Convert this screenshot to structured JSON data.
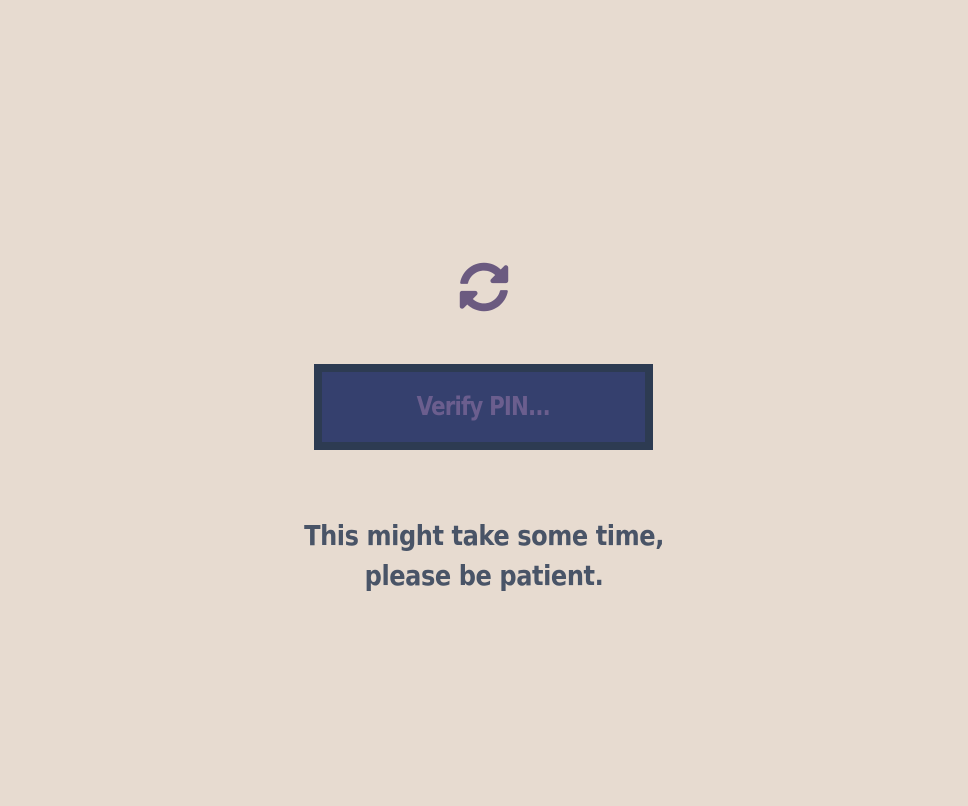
{
  "status": {
    "icon": "sync-icon",
    "icon_color": "#6b5a80"
  },
  "verify_button": {
    "label": "Verify PIN...",
    "state": "disabled"
  },
  "message": {
    "line1": "This might take some time,",
    "line2": "please be patient."
  },
  "colors": {
    "background": "#e7dbd0",
    "button_border": "#2d3b52",
    "button_fill": "#35406e",
    "button_text": "#6b5e8e",
    "message_text": "#495467"
  }
}
